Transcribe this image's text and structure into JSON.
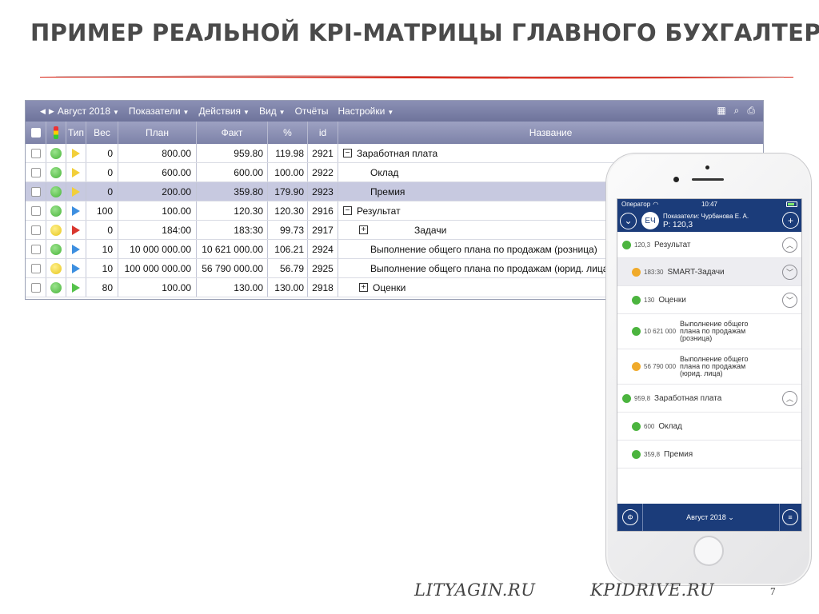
{
  "slide": {
    "title": "ПРИМЕР РЕАЛЬНОЙ KPI-МАТРИЦЫ ГЛАВНОГО БУХГАЛТЕРА",
    "accent_color": "#d92a1c",
    "footer_left": "LITYAGIN.RU",
    "footer_right": "KPIDRIVE.RU",
    "page_number": "7"
  },
  "toolbar": {
    "period": "Август 2018",
    "menus": [
      "Показатели",
      "Действия",
      "Вид",
      "Отчёты",
      "Настройки"
    ],
    "icons": [
      "grid-icon",
      "search-icon",
      "print-icon"
    ]
  },
  "table": {
    "columns": [
      "",
      "",
      "Тип",
      "Вес",
      "План",
      "Факт",
      "%",
      "id",
      "Название"
    ],
    "rows": [
      {
        "status": "green",
        "type": "yellow",
        "weight": "0",
        "plan": "800.00",
        "fact": "959.80",
        "pct": "119.98",
        "id": "2921",
        "name": "Заработная плата",
        "toggle": "minus",
        "indent": 0,
        "selected": false
      },
      {
        "status": "green",
        "type": "yellow",
        "weight": "0",
        "plan": "600.00",
        "fact": "600.00",
        "pct": "100.00",
        "id": "2922",
        "name": "Оклад",
        "toggle": "",
        "indent": 1,
        "selected": false
      },
      {
        "status": "green",
        "type": "yellow",
        "weight": "0",
        "plan": "200.00",
        "fact": "359.80",
        "pct": "179.90",
        "id": "2923",
        "name": "Премия",
        "toggle": "",
        "indent": 1,
        "selected": true
      },
      {
        "status": "green",
        "type": "blue",
        "weight": "100",
        "plan": "100.00",
        "fact": "120.30",
        "pct": "120.30",
        "id": "2916",
        "name": "Результат",
        "toggle": "minus",
        "indent": 0,
        "selected": false
      },
      {
        "status": "yellow",
        "type": "red",
        "weight": "0",
        "plan": "184:00",
        "fact": "183:30",
        "pct": "99.73",
        "id": "2917",
        "name": "Задачи",
        "toggle": "plus",
        "indent": 2,
        "selected": false
      },
      {
        "status": "green",
        "type": "blue",
        "weight": "10",
        "plan": "10 000 000.00",
        "fact": "10 621 000.00",
        "pct": "106.21",
        "id": "2924",
        "name": "Выполнение общего плана по продажам (розница)",
        "toggle": "",
        "indent": 1,
        "selected": false
      },
      {
        "status": "yellow",
        "type": "blue",
        "weight": "10",
        "plan": "100 000 000.00",
        "fact": "56 790 000.00",
        "pct": "56.79",
        "id": "2925",
        "name": "Выполнение общего плана по продажам (юрид. лица)",
        "toggle": "",
        "indent": 1,
        "selected": false
      },
      {
        "status": "green",
        "type": "green",
        "weight": "80",
        "plan": "100.00",
        "fact": "130.00",
        "pct": "130.00",
        "id": "2918",
        "name": "Оценки",
        "toggle": "plus",
        "indent": 3,
        "selected": false
      }
    ]
  },
  "phone": {
    "status": {
      "carrier": "Оператор",
      "time": "10:47"
    },
    "header": {
      "initials": "ЕЧ",
      "line1": "Показатели: Чурбанова Е. А.",
      "line2": "Р: 120,3"
    },
    "items": [
      {
        "value": "120,3",
        "label": "Результат",
        "color": "green",
        "chevron": "up",
        "indent": 0,
        "highlight": false
      },
      {
        "value": "183:30",
        "label": "SMART-Задачи",
        "color": "orange",
        "chevron": "down",
        "indent": 1,
        "highlight": true
      },
      {
        "value": "130",
        "label": "Оценки",
        "color": "green",
        "chevron": "down",
        "indent": 1,
        "highlight": false
      },
      {
        "value": "10 621 000",
        "label": "Выполнение общего плана по продажам (розница)",
        "color": "green",
        "chevron": "",
        "indent": 1,
        "highlight": false
      },
      {
        "value": "56 790 000",
        "label": "Выполнение общего плана по продажам (юрид. лица)",
        "color": "orange",
        "chevron": "",
        "indent": 1,
        "highlight": false
      },
      {
        "value": "959,8",
        "label": "Заработная плата",
        "color": "green",
        "chevron": "up",
        "indent": 0,
        "highlight": false
      },
      {
        "value": "600",
        "label": "Оклад",
        "color": "green",
        "chevron": "",
        "indent": 1,
        "highlight": false
      },
      {
        "value": "359,8",
        "label": "Премия",
        "color": "green",
        "chevron": "",
        "indent": 1,
        "highlight": false
      }
    ],
    "tabbar": {
      "month": "Август 2018"
    }
  }
}
